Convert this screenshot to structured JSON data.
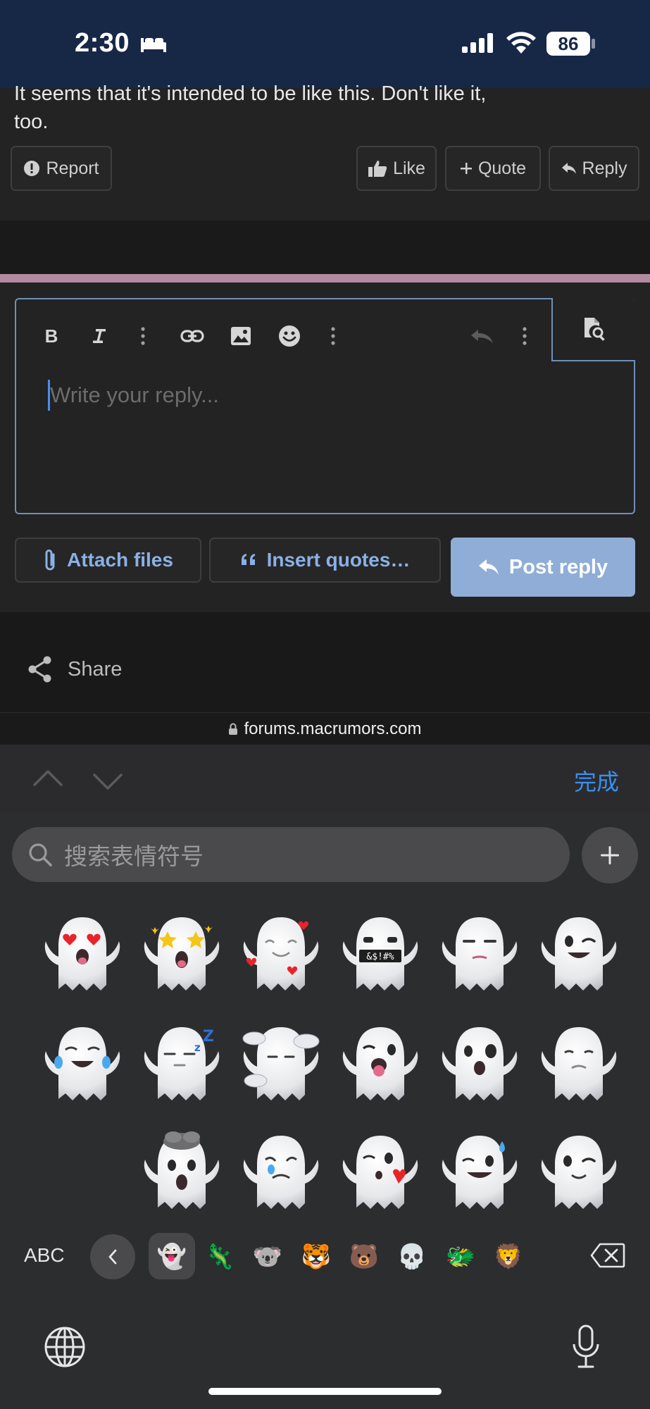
{
  "status_bar": {
    "time": "2:30",
    "battery": "86"
  },
  "post": {
    "text_line1": "It seems that it's intended to be like this. Don't like it,",
    "text_line2": "too.",
    "report": "Report",
    "like": "Like",
    "quote": "Quote",
    "reply": "Reply"
  },
  "editor": {
    "placeholder": "Write your reply...",
    "attach_files": "Attach files",
    "insert_quotes": "Insert quotes…",
    "post_reply": "Post reply"
  },
  "share": "Share",
  "url": "forums.macrumors.com",
  "keyboard": {
    "done": "完成",
    "search_placeholder": "搜索表情符号",
    "abc": "ABC",
    "categories": [
      "👻",
      "🦎",
      "🐨",
      "🐯",
      "🐻",
      "💀",
      "🐲",
      "🦁"
    ]
  },
  "stickers": [
    [
      "heart-eyes-ghost",
      "star-eyes-ghost",
      "smiling-hearts-ghost",
      "cursing-ghost",
      "unamused-ghost",
      "winking-ghost"
    ],
    [
      "tears-of-joy-ghost",
      "sleeping-ghost",
      "face-in-clouds-ghost",
      "tongue-wink-ghost",
      "surprised-ghost",
      "sad-ghost"
    ],
    [
      "",
      "exploding-head-ghost",
      "crying-ghost",
      "kissing-ghost",
      "sweat-smile-ghost",
      "peeking-ghost"
    ]
  ]
}
